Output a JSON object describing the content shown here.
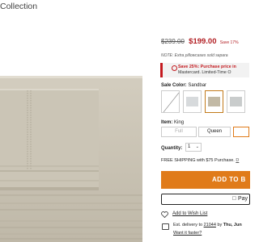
{
  "header": {
    "collection": "Collection"
  },
  "price": {
    "original": "$239.00",
    "sale": "$199.00",
    "save": "Save 17%"
  },
  "note": "NOTE: Extra pillowcases sold separa",
  "promo": {
    "line1": "Save 25%: Purchase price in",
    "line2": "Mastercard. Limited-Time O"
  },
  "color": {
    "label": "Sale Color:",
    "value": "Sandbar",
    "swatches": [
      {
        "name": "white-swatch",
        "hex": "#ffffff"
      },
      {
        "name": "light-gray-swatch",
        "hex": "#d7dadc"
      },
      {
        "name": "sandbar-swatch",
        "hex": "#c2b9a5"
      },
      {
        "name": "gray-swatch",
        "hex": "#c9cccc"
      }
    ]
  },
  "item": {
    "label": "Item:",
    "value": "King",
    "sizes": [
      "Full",
      "Queen"
    ]
  },
  "quantity": {
    "label": "Quantity:",
    "value": "1"
  },
  "shipping": {
    "text": "FREE SHIPPING with $75 Purchase.",
    "link": "D"
  },
  "cart": {
    "label": "ADD TO B"
  },
  "apple_pay": {
    "label": "Pay"
  },
  "wishlist": {
    "label": "Add to Wish List"
  },
  "delivery": {
    "prefix": "Est. delivery to",
    "zip": "21044",
    "mid": "by",
    "date": "Thu, Jun",
    "faster": "Want it faster?"
  },
  "colors": {
    "accent": "#e07b1a",
    "sale": "#b21f24",
    "sheet": "#c9c3b4"
  }
}
